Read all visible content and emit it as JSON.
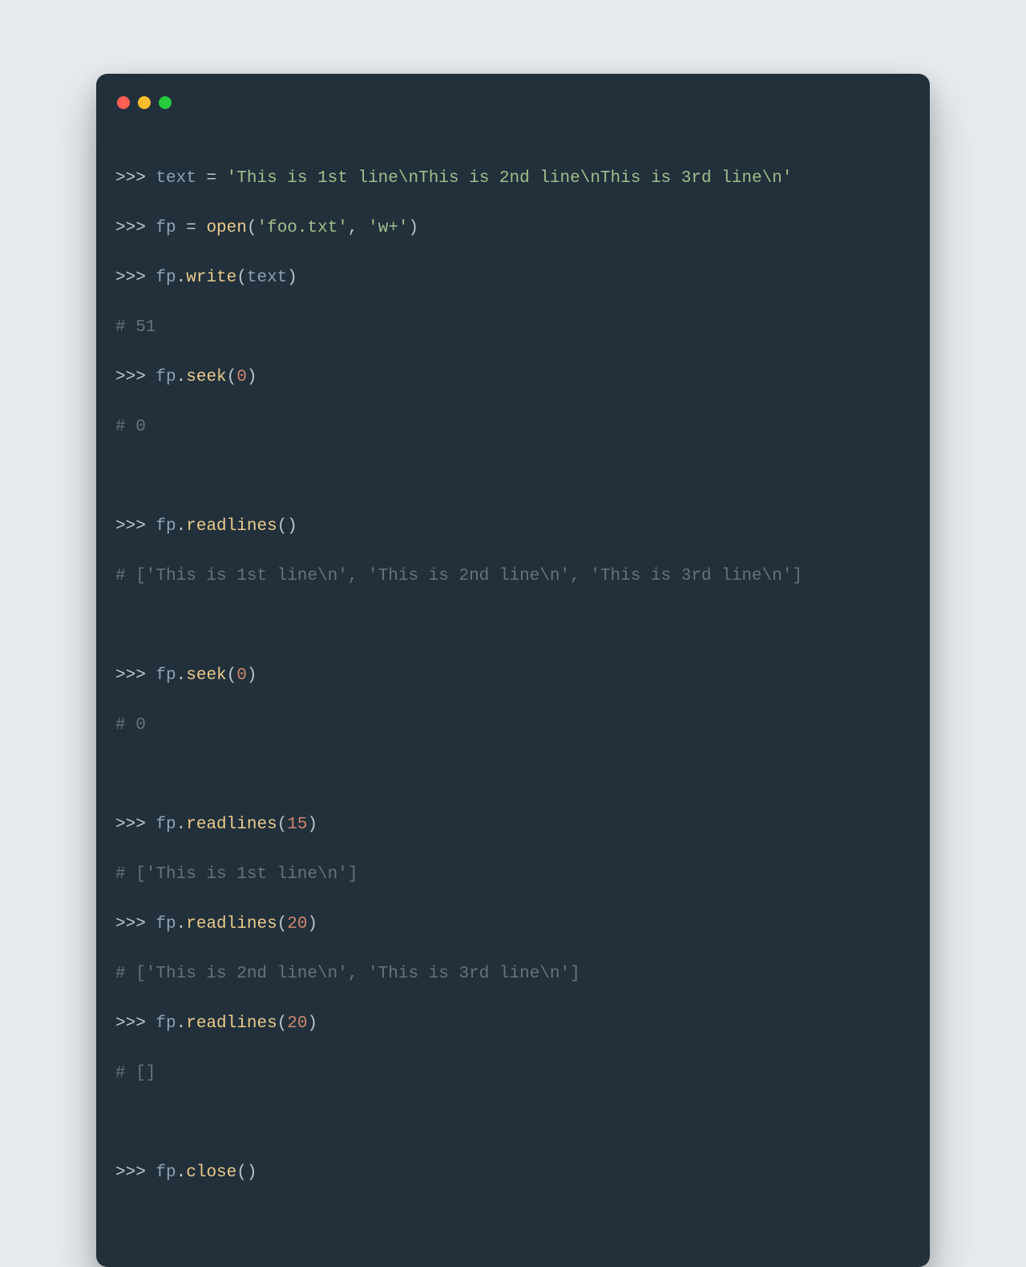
{
  "colors": {
    "bg": "#e6ebef",
    "terminal_bg": "#21303b",
    "red": "#ff5f56",
    "yellow": "#ffbd2e",
    "green": "#27c93f",
    "var": "#8fa1b3",
    "str": "#a3be8c",
    "func": "#ebcb8b",
    "num": "#d08770",
    "comment": "#65737e",
    "default": "#c0c5ce"
  },
  "tokens": {
    "prompt": ">>> ",
    "assign": " = ",
    "dot": ".",
    "lp": "(",
    "rp": ")",
    "comma": ", ",
    "text_var": "text",
    "fp_var": "fp",
    "open_fn": "open",
    "write_fn": "write",
    "seek_fn": "seek",
    "readlines_fn": "readlines",
    "close_fn": "close",
    "str_text": "'This is 1st line\\nThis is 2nd line\\nThis is 3rd line\\n'",
    "str_foo": "'foo.txt'",
    "str_mode": "'w+'",
    "num_0": "0",
    "num_15": "15",
    "num_20": "20",
    "c_51": "# 51",
    "c_0": "# 0",
    "c_readlines_all": "# ['This is 1st line\\n', 'This is 2nd line\\n', 'This is 3rd line\\n']",
    "c_readlines_1": "# ['This is 1st line\\n']",
    "c_readlines_23": "# ['This is 2nd line\\n', 'This is 3rd line\\n']",
    "c_empty": "# []"
  }
}
